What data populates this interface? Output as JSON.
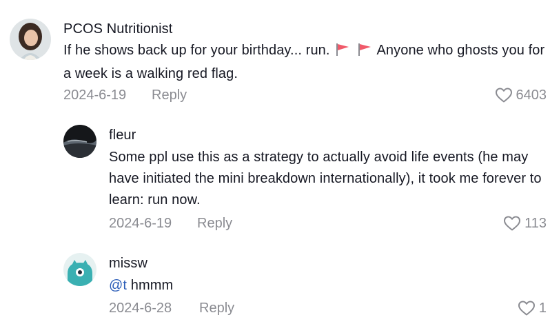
{
  "comments": [
    {
      "username": "PCOS Nutritionist",
      "text_part1": "If he shows back up for your birthday... run.",
      "flag_icons": [
        "red-flag-icon",
        "red-flag-icon"
      ],
      "text_part2": "Anyone who ghosts you for a week is a walking red flag.",
      "date": "2024-6-19",
      "reply_label": "Reply",
      "likes": "6403"
    },
    {
      "username": "fleur",
      "text": "Some ppl use this as a strategy to actually avoid life events (he may have initiated the mini breakdown internationally), it took me forever to learn: run now.",
      "date": "2024-6-19",
      "reply_label": "Reply",
      "likes": "113"
    },
    {
      "username": "missw",
      "mention": "@t",
      "text": "hmmm",
      "date": "2024-6-28",
      "reply_label": "Reply",
      "likes": "1"
    }
  ],
  "colors": {
    "text": "#161823",
    "muted": "#8a8b91",
    "mention": "#2b5db8",
    "flag": "#f05a6a"
  }
}
